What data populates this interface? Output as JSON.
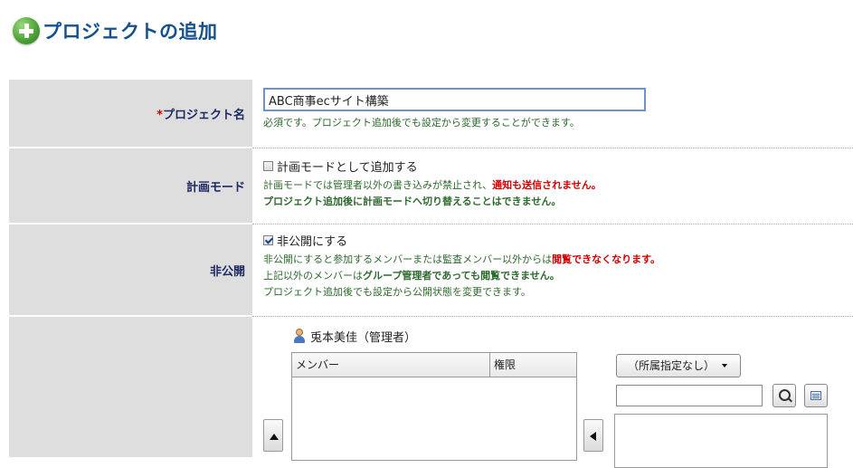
{
  "header": {
    "title": "プロジェクトの追加",
    "icon": "plus-circle-icon"
  },
  "form": {
    "project_name": {
      "required_mark": "*",
      "label": "プロジェクト名",
      "value": "ABC商事ecサイト構築",
      "hint": "必須です。プロジェクト追加後でも設定から変更することができます。"
    },
    "plan_mode": {
      "label": "計画モード",
      "checkbox_label": "計画モードとして追加する",
      "checked": false,
      "hint1_prefix": "計画モードでは管理者以外の書き込みが禁止され、",
      "hint1_red": "通知も送信されません。",
      "hint2_bold": "プロジェクト追加後に計画モードへ切り替えることはできません。"
    },
    "private": {
      "label": "非公開",
      "checkbox_label": "非公開にする",
      "checked": true,
      "hint1_prefix": "非公開にすると参加するメンバーまたは監査メンバー以外からは",
      "hint1_red": "閲覧できなくなります。",
      "hint2_prefix": "上記以外のメンバーは",
      "hint2_bold": "グループ管理者であっても閲覧できません。",
      "hint3": "プロジェクト追加後でも設定から公開状態を変更できます。"
    },
    "members": {
      "current_user": "兎本美佳（管理者）",
      "columns": [
        "メンバー",
        "権限"
      ],
      "group_select": "（所属指定なし）",
      "search_value": ""
    }
  }
}
